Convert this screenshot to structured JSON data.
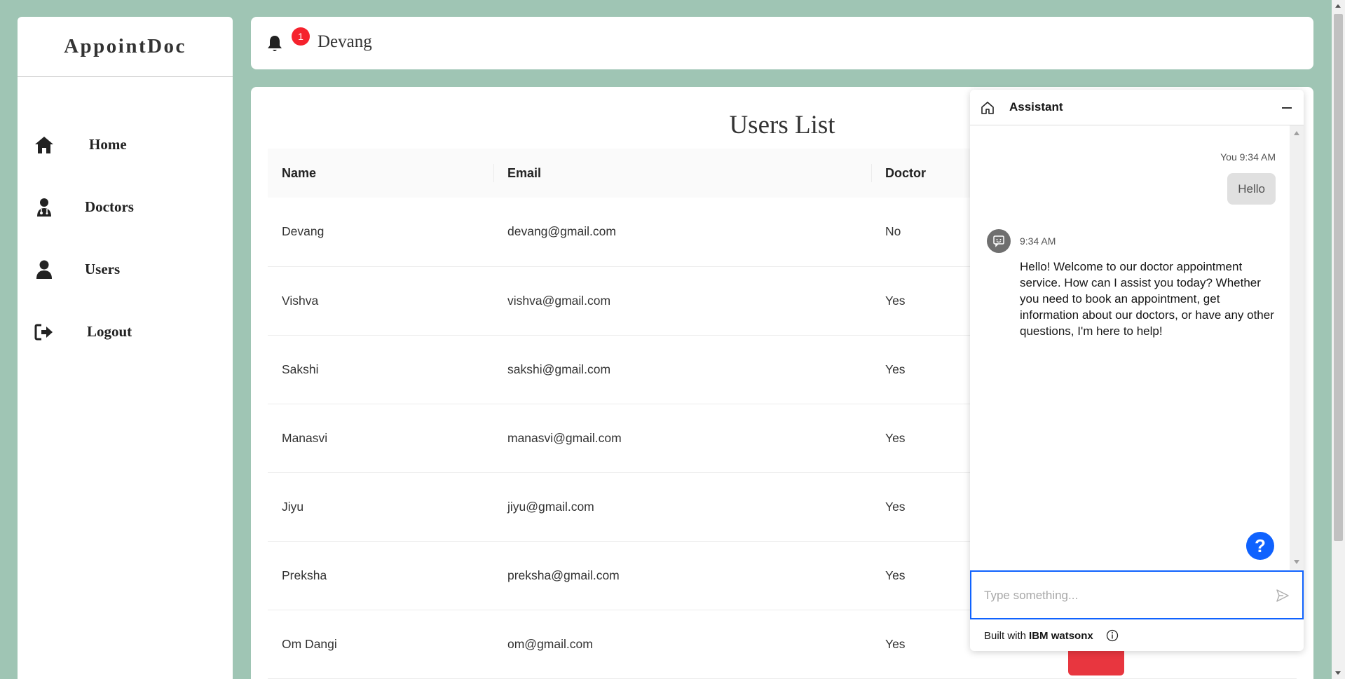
{
  "app": {
    "logo": "AppointDoc"
  },
  "sidebar": {
    "items": [
      {
        "label": "Home",
        "icon": "home-icon"
      },
      {
        "label": "Doctors",
        "icon": "doctor-icon"
      },
      {
        "label": "Users",
        "icon": "user-icon"
      },
      {
        "label": "Logout",
        "icon": "logout-icon"
      }
    ]
  },
  "header": {
    "notification_count": "1",
    "user_name": "Devang"
  },
  "main": {
    "title": "Users List",
    "table": {
      "columns": [
        "Name",
        "Email",
        "Doctor"
      ],
      "rows": [
        {
          "name": "Devang",
          "email": "devang@gmail.com",
          "doctor": "No"
        },
        {
          "name": "Vishva",
          "email": "vishva@gmail.com",
          "doctor": "Yes"
        },
        {
          "name": "Sakshi",
          "email": "sakshi@gmail.com",
          "doctor": "Yes"
        },
        {
          "name": "Manasvi",
          "email": "manasvi@gmail.com",
          "doctor": "Yes"
        },
        {
          "name": "Jiyu",
          "email": "jiyu@gmail.com",
          "doctor": "Yes"
        },
        {
          "name": "Preksha",
          "email": "preksha@gmail.com",
          "doctor": "Yes"
        },
        {
          "name": "Om Dangi",
          "email": "om@gmail.com",
          "doctor": "Yes"
        }
      ]
    }
  },
  "assistant": {
    "title": "Assistant",
    "user_message": {
      "meta": "You 9:34 AM",
      "text": "Hello"
    },
    "bot_message": {
      "time": "9:34 AM",
      "text": "Hello! Welcome to our doctor appointment service. How can I assist you today? Whether you need to book an appointment, get information about our doctors, or have any other questions, I'm here to help!"
    },
    "help_label": "?",
    "input_placeholder": "Type something...",
    "footer_prefix": "Built with",
    "footer_brand": "IBM watsonx"
  },
  "colors": {
    "background": "#9fc5b4",
    "badge": "#f5222d",
    "accent": "#0f62fe",
    "danger": "#e8363f"
  }
}
